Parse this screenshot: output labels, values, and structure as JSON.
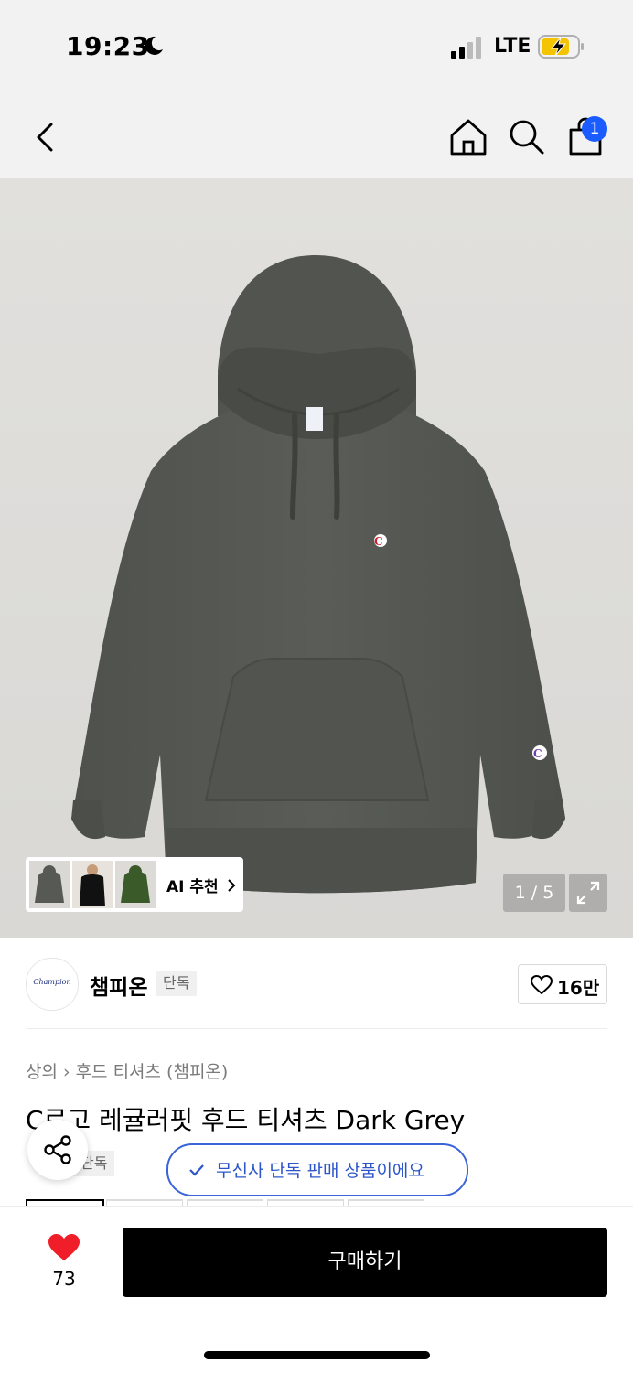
{
  "status_bar": {
    "time": "19:23",
    "network": "LTE"
  },
  "header": {
    "cart_count": "1"
  },
  "gallery": {
    "ai_recommend_label": "AI 추천",
    "pager": "1 / 5"
  },
  "brand": {
    "logo_text": "Champion",
    "name": "챔피온",
    "exclusive_tag": "단독",
    "likes": "16만"
  },
  "product": {
    "breadcrumb": [
      "상의",
      "후드 티셔츠 (챔피온)"
    ],
    "title": "C로고 레귤러핏 후드 티셔츠 Dark Grey",
    "exclusive_tag": "단독"
  },
  "toast": {
    "message": "무신사 단독 판매 상품이에요"
  },
  "bottom_bar": {
    "wish_count": "73",
    "buy_label": "구매하기"
  },
  "colors": {
    "accent_blue": "#1a5cff",
    "toast_blue": "#2d55c9",
    "heart_red": "#f01e28",
    "hoodie": "#555853"
  }
}
